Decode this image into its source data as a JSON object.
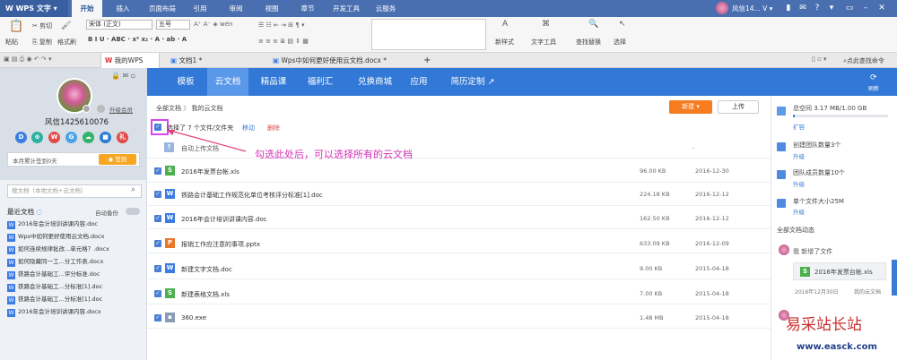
{
  "titlebar": {
    "app_name": "W WPS 文字 ▾",
    "menus": [
      "开始",
      "插入",
      "页面布局",
      "引用",
      "审阅",
      "视图",
      "章节",
      "开发工具",
      "云服务"
    ],
    "user": "风信14... V ▾"
  },
  "ribbon": {
    "paste": "粘贴",
    "cut": "剪切",
    "copy": "复制",
    "format_painter": "格式刷",
    "font_name": "宋体 (正文)",
    "font_size": "五号",
    "format_row": "B I U · ABC · x² x₂ · A · ab · A",
    "new_style": "新样式",
    "text_tools": "文字工具",
    "find_replace": "查找替换",
    "select": "选择"
  },
  "tabs": {
    "my_wps": "我的WPS",
    "doc1": "文档1 *",
    "doc2": "Wps中如何更好使用云文档.docx *",
    "add": "+",
    "prompt": "点此查找命令"
  },
  "left": {
    "vip_link": "升级会员",
    "username": "风信1425610076",
    "app_icons": [
      "D",
      "⊕",
      "W",
      "G",
      "☁",
      "■",
      "礼"
    ],
    "checkin_text": "本月累计签到0天",
    "checkin_btn": "签到",
    "search_placeholder": "搜文档（本地文档+云文档）",
    "recent_title": "最近文档",
    "auto_backup": "自动备份",
    "recent": [
      "2016年会计培训讲课内容.doc",
      "Wps中如何更好使用云文档.docx",
      "如何连续规律批改...单元格？.docx",
      "如何隐藏同一工...分工作表.docx",
      "铁路会计基础工...评分标准.doc",
      "铁路会计基础工...分标准[1].doc",
      "铁路会计基础工...分标准[1].doc",
      "2016年会计培训讲课内容.docx"
    ]
  },
  "cloudnav": {
    "items": [
      "模板",
      "云文档",
      "精品课",
      "福利汇",
      "兑换商城",
      "应用",
      "简历定制"
    ],
    "refresh": "刷新"
  },
  "main": {
    "breadcrumb_all": "全部文档",
    "breadcrumb_sep": "》",
    "breadcrumb_cloud": "我的云文档",
    "new_btn": "新建",
    "upload_btn": "上传",
    "selected_text": "选择了 7 个文件/文件夹",
    "move": "移动",
    "delete": "删除",
    "auto_upload": "自动上传文档",
    "auto_upload_dash": "-",
    "annotation": "勾选此处后，可以选择所有的云文档",
    "files": [
      {
        "name": "2016年发票台帐.xls",
        "size": "96.00 KB",
        "date": "2016-12-30",
        "type": "S",
        "color": "#4caf50"
      },
      {
        "name": "铁路会计基础工作规范化单位考核评分标准[1].doc",
        "size": "224.18 KB",
        "date": "2016-12-12",
        "type": "W",
        "color": "#3d7be3"
      },
      {
        "name": "2016年会计培训讲课内容.doc",
        "size": "162.50 KB",
        "date": "2016-12-12",
        "type": "W",
        "color": "#3d7be3"
      },
      {
        "name": "报销工作应注意的事项.pptx",
        "size": "633.09 KB",
        "date": "2016-12-09",
        "type": "P",
        "color": "#e8762b"
      },
      {
        "name": "新建文字文档.doc",
        "size": "9.00 KB",
        "date": "2015-04-18",
        "type": "W",
        "color": "#3d7be3"
      },
      {
        "name": "新建表格文档.xls",
        "size": "7.00 KB",
        "date": "2015-04-18",
        "type": "S",
        "color": "#4caf50"
      },
      {
        "name": "360.exe",
        "size": "1.48 MB",
        "date": "2015-04-18",
        "type": "▪",
        "color": "#8a9bb5"
      }
    ]
  },
  "right": {
    "space": "总空间 3.17 MB/1.00 GB",
    "space_fraction": 0.003,
    "expand": "扩容",
    "team_count": "创建团队数量3个",
    "team_upgrade": "升级",
    "member_count": "团队成员数量10个",
    "member_upgrade": "升级",
    "file_limit": "单个文件大小25M",
    "limit_upgrade": "升级",
    "activity_title": "全部文档动态",
    "activity_user": "我 新增了文件",
    "activity_file": "2016年发票台帐.xls",
    "activity_date": "2016年12月30日",
    "activity_source": "我的云文档"
  },
  "watermark": {
    "text": "易采站长站",
    "url": "www.easck.com"
  }
}
